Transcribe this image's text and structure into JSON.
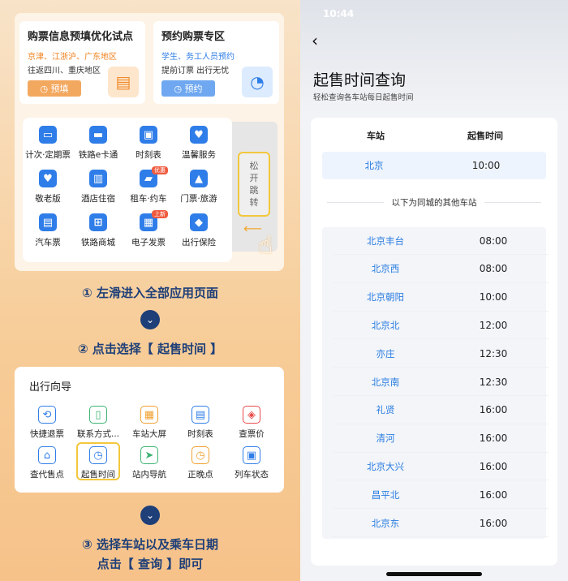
{
  "left": {
    "promo1": {
      "title": "购票信息预填优化试点",
      "line1": "京津、江浙沪、广东地区",
      "line2": "往返四川、重庆地区",
      "button": "预填"
    },
    "promo2": {
      "title": "预约购票专区",
      "line1": "学生、务工人员预约",
      "line2": "提前订票 出行无忧",
      "button": "预约"
    },
    "apps": [
      {
        "label": "计次·定期票",
        "icon": "ticket-card-icon",
        "color": "#2f7de8"
      },
      {
        "label": "铁路e卡通",
        "icon": "e-card-icon",
        "color": "#2f7de8"
      },
      {
        "label": "时刻表",
        "icon": "train-icon",
        "color": "#2f7de8"
      },
      {
        "label": "温馨服务",
        "icon": "heart-box-icon",
        "color": "#2f7de8"
      },
      {
        "label": "敬老版",
        "icon": "heart-icon",
        "color": "#2f7de8"
      },
      {
        "label": "酒店住宿",
        "icon": "building-icon",
        "color": "#2f7de8"
      },
      {
        "label": "租车·约车",
        "icon": "car-icon",
        "color": "#2f7de8",
        "badge": "优惠"
      },
      {
        "label": "门票·旅游",
        "icon": "mountain-icon",
        "color": "#2f7de8"
      },
      {
        "label": "汽车票",
        "icon": "bus-icon",
        "color": "#2f7de8"
      },
      {
        "label": "铁路商城",
        "icon": "cart-icon",
        "color": "#2f7de8"
      },
      {
        "label": "电子发票",
        "icon": "printer-icon",
        "color": "#2f7de8",
        "badge": "上新"
      },
      {
        "label": "出行保险",
        "icon": "shield-icon",
        "color": "#2f7de8"
      }
    ],
    "release_text": "松开跳转",
    "step1": "① 左滑进入全部应用页面",
    "step2": "② 点击选择【 起售时间 】",
    "guide": {
      "title": "出行向导",
      "items": [
        {
          "label": "快捷退票",
          "icon": "refund-icon",
          "color": "#2f7de8"
        },
        {
          "label": "联系方式...",
          "icon": "phone-icon",
          "color": "#3cb371"
        },
        {
          "label": "车站大屏",
          "icon": "grid-screen-icon",
          "color": "#f0a030"
        },
        {
          "label": "时刻表",
          "icon": "schedule-icon",
          "color": "#2f7de8"
        },
        {
          "label": "查票价",
          "icon": "price-ticket-icon",
          "color": "#e84a4a"
        },
        {
          "label": "查代售点",
          "icon": "house-icon",
          "color": "#2f7de8"
        },
        {
          "label": "起售时间",
          "icon": "clock-ticket-icon",
          "color": "#2f7de8"
        },
        {
          "label": "站内导航",
          "icon": "navigation-icon",
          "color": "#3cb371"
        },
        {
          "label": "正晚点",
          "icon": "clock-icon",
          "color": "#f0a030"
        },
        {
          "label": "列车状态",
          "icon": "train-status-icon",
          "color": "#2f7de8"
        }
      ]
    },
    "step3_line1": "③ 选择车站以及乘车日期",
    "step3_line2": "点击【 查询 】即可"
  },
  "right": {
    "status_time": "10:44",
    "title": "起售时间查询",
    "subtitle": "轻松查询各车站每日起售时间",
    "header_station": "车站",
    "header_time": "起售时间",
    "main_station": {
      "station": "北京",
      "time": "10:00"
    },
    "divider_text": "以下为同城的其他车站",
    "stations": [
      {
        "station": "北京丰台",
        "time": "08:00"
      },
      {
        "station": "北京西",
        "time": "08:00"
      },
      {
        "station": "北京朝阳",
        "time": "10:00"
      },
      {
        "station": "北京北",
        "time": "12:00"
      },
      {
        "station": "亦庄",
        "time": "12:30"
      },
      {
        "station": "北京南",
        "time": "12:30"
      },
      {
        "station": "礼贤",
        "time": "16:00"
      },
      {
        "station": "清河",
        "time": "16:00"
      },
      {
        "station": "北京大兴",
        "time": "16:00"
      },
      {
        "station": "昌平北",
        "time": "16:00"
      },
      {
        "station": "北京东",
        "time": "16:00"
      }
    ]
  }
}
